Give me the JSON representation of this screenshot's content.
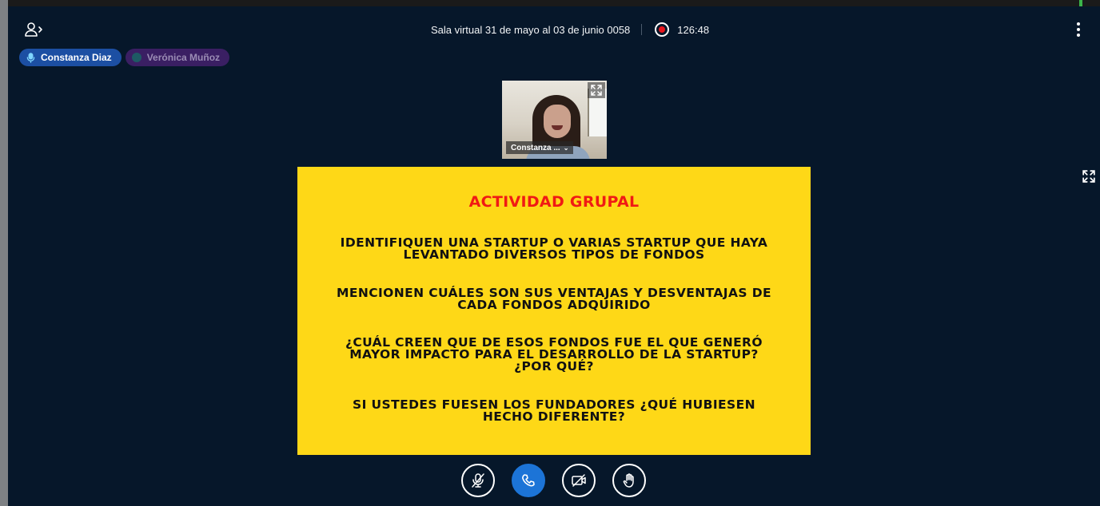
{
  "header": {
    "room_title": "Sala virtual 31 de mayo al 03 de junio 0058",
    "recording_time": "126:48",
    "users_toggle_icon": "user-list-toggle-icon",
    "options_icon": "more-vertical-icon"
  },
  "talkers": [
    {
      "name": "Constanza Diaz",
      "state": "talking",
      "icon": "microphone-icon"
    },
    {
      "name": "Verónica Muñoz",
      "state": "muted",
      "icon": "avatar-dot"
    }
  ],
  "webcam": {
    "name": "Constanza ...",
    "fullscreen_icon": "expand-icon"
  },
  "presentation": {
    "fullscreen_icon": "expand-icon",
    "title": "ACTIVIDAD GRUPAL",
    "questions": [
      "IDENTIFIQUEN UNA STARTUP O VARIAS STARTUP QUE HAYA LEVANTADO DIVERSOS TIPOS DE FONDOS",
      "MENCIONEN CUÁLES SON SUS VENTAJAS Y DESVENTAJAS DE CADA FONDOS ADQUIRIDO",
      "¿CUÁL CREEN QUE DE ESOS FONDOS FUE EL QUE GENERÓ MAYOR IMPACTO PARA EL DESARROLLO DE LA STARTUP? ¿POR QUÉ?",
      "SI USTEDES FUESEN LOS FUNDADORES ¿QUÉ HUBIESEN HECHO DIFERENTE?"
    ]
  },
  "controls": [
    {
      "name": "mute-microphone",
      "icon": "microphone-off-icon"
    },
    {
      "name": "leave-audio",
      "icon": "phone-icon"
    },
    {
      "name": "share-camera",
      "icon": "camera-off-icon"
    },
    {
      "name": "raise-hand",
      "icon": "hand-icon"
    }
  ],
  "colors": {
    "background": "#06172a",
    "talker_active": "#1c4fa3",
    "talker_muted": "#3a1f63",
    "slide_background": "#fed817",
    "slide_title": "#f01a14",
    "primary_button": "#1c74d7",
    "record_dot": "#e8151c"
  }
}
